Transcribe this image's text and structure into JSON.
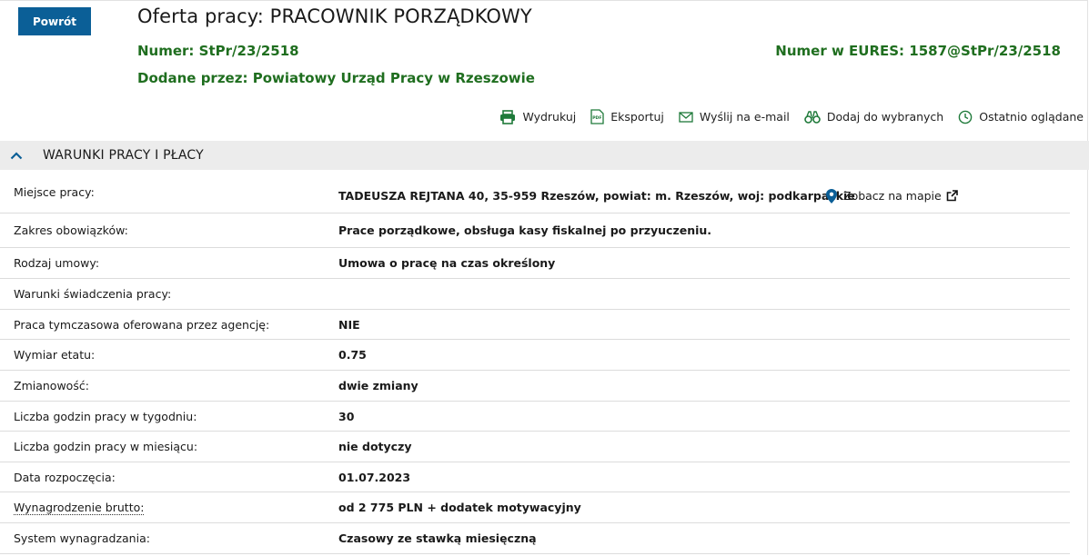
{
  "back_button": "Powrót",
  "title": "Oferta pracy: PRACOWNIK PORZĄDKOWY",
  "number": {
    "label": "Numer:",
    "value": "StPr/23/2518"
  },
  "eures": {
    "label": "Numer w EURES:",
    "value": "1587@StPr/23/2518"
  },
  "added_by": {
    "label": "Dodane przez:",
    "value": "Powiatowy Urząd Pracy w Rzeszowie"
  },
  "actions": [
    {
      "label": "Wydrukuj",
      "icon": "printer-icon"
    },
    {
      "label": "Eksportuj",
      "icon": "pdf-icon"
    },
    {
      "label": "Wyślij na e-mail",
      "icon": "envelope-icon"
    },
    {
      "label": "Dodaj do wybranych",
      "icon": "binoculars-icon"
    },
    {
      "label": "Ostatnio oglądane",
      "icon": "clock-icon"
    }
  ],
  "section": {
    "title": "WARUNKI PRACY I PŁACY"
  },
  "map_link": "Zobacz na mapie",
  "rows": [
    {
      "label": "Miejsce pracy:",
      "value": "TADEUSZA REJTANA 40, 35-959 Rzeszów, powiat: m. Rzeszów, woj: podkarpackie"
    },
    {
      "label": "Zakres obowiązków:",
      "value": "Prace porządkowe, obsługa kasy fiskalnej po przyuczeniu."
    },
    {
      "label": "Rodzaj umowy:",
      "value": "Umowa o pracę na czas określony"
    },
    {
      "label": "Warunki świadczenia pracy:",
      "value": ""
    },
    {
      "label": "Praca tymczasowa oferowana przez agencję:",
      "value": "NIE"
    },
    {
      "label": "Wymiar etatu:",
      "value": "0.75"
    },
    {
      "label": "Zmianowość:",
      "value": "dwie zmiany"
    },
    {
      "label": "Liczba godzin pracy w tygodniu:",
      "value": "30"
    },
    {
      "label": "Liczba godzin pracy w miesiącu:",
      "value": "nie dotyczy"
    },
    {
      "label": "Data rozpoczęcia:",
      "value": "01.07.2023"
    },
    {
      "label": "Wynagrodzenie brutto:",
      "value": "od 2 775 PLN + dodatek motywacyjny"
    },
    {
      "label": "System wynagradzania:",
      "value": "Czasowy ze stawką miesięczną"
    }
  ]
}
